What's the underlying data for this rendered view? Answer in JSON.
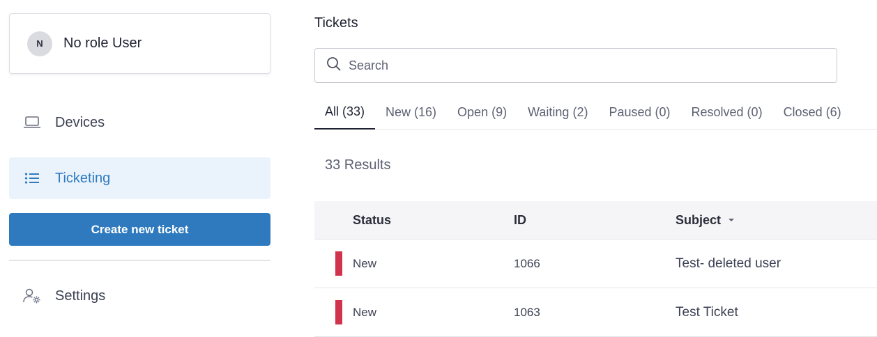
{
  "sidebar": {
    "user": {
      "initial": "N",
      "name": "No role User"
    },
    "nav": {
      "devices": "Devices",
      "ticketing": "Ticketing",
      "settings": "Settings"
    },
    "create_button": "Create new ticket"
  },
  "main": {
    "title": "Tickets",
    "search": {
      "placeholder": "Search",
      "value": ""
    },
    "tabs": [
      {
        "label": "All (33)",
        "active": true
      },
      {
        "label": "New (16)"
      },
      {
        "label": "Open (9)"
      },
      {
        "label": "Waiting (2)"
      },
      {
        "label": "Paused (0)"
      },
      {
        "label": "Resolved (0)"
      },
      {
        "label": "Closed (6)"
      }
    ],
    "results": "33 Results",
    "table": {
      "headers": {
        "status": "Status",
        "id": "ID",
        "subject": "Subject"
      },
      "rows": [
        {
          "status": "New",
          "id": "1066",
          "subject": "Test- deleted user"
        },
        {
          "status": "New",
          "id": "1063",
          "subject": "Test Ticket"
        }
      ]
    }
  },
  "colors": {
    "accent": "#2f7abf",
    "active_nav_bg": "#eaf3fc",
    "status_new": "#d1344a"
  },
  "icons": {
    "devices": "laptop-icon",
    "ticketing": "list-icon",
    "settings": "user-gear-icon",
    "search": "search-icon",
    "sort": "caret-down-icon"
  }
}
